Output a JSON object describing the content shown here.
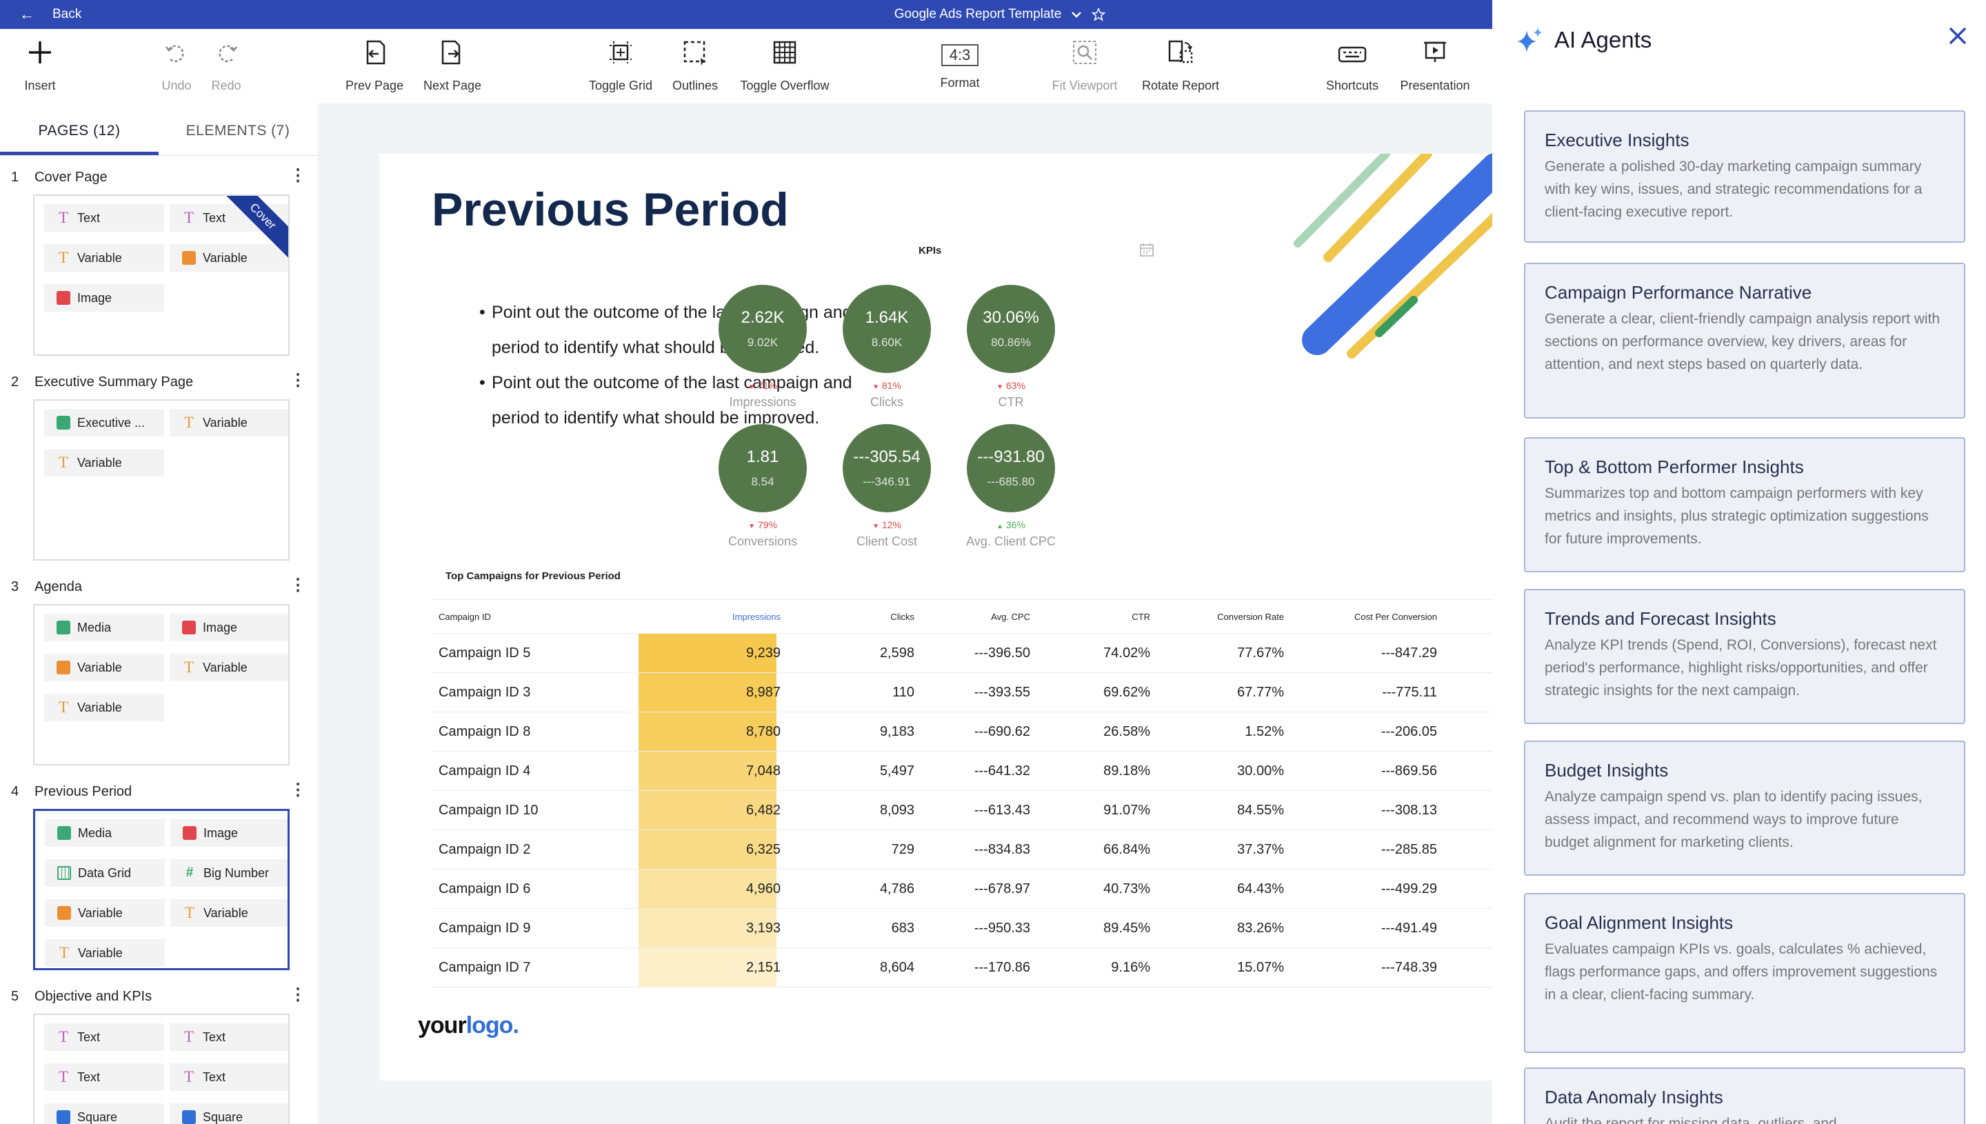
{
  "topbar": {
    "back_label": "Back",
    "doc_title": "Google Ads Report Template"
  },
  "toolbar": {
    "insert": "Insert",
    "undo": "Undo",
    "redo": "Redo",
    "prev_page": "Prev Page",
    "next_page": "Next Page",
    "toggle_grid": "Toggle Grid",
    "outlines": "Outlines",
    "toggle_overflow": "Toggle Overflow",
    "format_ratio": "4:3",
    "format": "Format",
    "fit_viewport": "Fit Viewport",
    "rotate_report": "Rotate Report",
    "shortcuts": "Shortcuts",
    "presentation": "Presentation"
  },
  "left_panel": {
    "tab_pages": "PAGES (12)",
    "tab_elements": "ELEMENTS (7)",
    "pages": [
      {
        "num": "1",
        "name": "Cover Page",
        "badge": "Cover",
        "chips": [
          {
            "icon": "text-icon",
            "label": "Text"
          },
          {
            "icon": "text-icon",
            "label": "Text"
          },
          {
            "icon": "variable-icon",
            "label": "Variable"
          },
          {
            "icon": "image-variable-icon",
            "label": "Variable"
          },
          {
            "icon": "image-icon",
            "label": "Image"
          }
        ]
      },
      {
        "num": "2",
        "name": "Executive Summary Page",
        "chips": [
          {
            "icon": "executive-icon",
            "label": "Executive ..."
          },
          {
            "icon": "variable-icon",
            "label": "Variable"
          },
          {
            "icon": "variable-icon",
            "label": "Variable"
          }
        ]
      },
      {
        "num": "3",
        "name": "Agenda",
        "chips": [
          {
            "icon": "media-icon",
            "label": "Media"
          },
          {
            "icon": "image-icon",
            "label": "Image"
          },
          {
            "icon": "image-variable-icon",
            "label": "Variable"
          },
          {
            "icon": "variable-icon",
            "label": "Variable"
          },
          {
            "icon": "variable-icon",
            "label": "Variable"
          }
        ]
      },
      {
        "num": "4",
        "name": "Previous Period",
        "chips": [
          {
            "icon": "media-icon",
            "label": "Media"
          },
          {
            "icon": "image-icon",
            "label": "Image"
          },
          {
            "icon": "data-grid-icon",
            "label": "Data Grid"
          },
          {
            "icon": "hash-icon",
            "label": "Big Number"
          },
          {
            "icon": "image-variable-icon",
            "label": "Variable"
          },
          {
            "icon": "variable-icon",
            "label": "Variable"
          },
          {
            "icon": "variable-icon",
            "label": "Variable"
          }
        ]
      },
      {
        "num": "5",
        "name": "Objective and KPIs",
        "chips": [
          {
            "icon": "text-icon",
            "label": "Text"
          },
          {
            "icon": "text-icon",
            "label": "Text"
          },
          {
            "icon": "text-icon",
            "label": "Text"
          },
          {
            "icon": "text-icon",
            "label": "Text"
          },
          {
            "icon": "square-icon",
            "label": "Square"
          },
          {
            "icon": "square-icon",
            "label": "Square"
          }
        ]
      }
    ]
  },
  "slide": {
    "title": "Previous Period",
    "bullets": [
      "Point out the outcome of the last campaign and period to identify what should be improved.",
      "Point out the outcome of the last campaign and period to identify what should be improved."
    ],
    "kpi_label": "KPIs",
    "kpis": [
      {
        "value": "2.62K",
        "prev": "9.02K",
        "change": "71%",
        "dir": "down",
        "name": "Impressions"
      },
      {
        "value": "1.64K",
        "prev": "8.60K",
        "change": "81%",
        "dir": "down",
        "name": "Clicks"
      },
      {
        "value": "30.06%",
        "prev": "80.86%",
        "change": "63%",
        "dir": "down",
        "name": "CTR"
      },
      {
        "value": "1.81",
        "prev": "8.54",
        "change": "79%",
        "dir": "down",
        "name": "Conversions"
      },
      {
        "value": "---305.54",
        "prev": "---346.91",
        "change": "12%",
        "dir": "down",
        "name": "Client Cost"
      },
      {
        "value": "---931.80",
        "prev": "---685.80",
        "change": "36%",
        "dir": "up",
        "name": "Avg. Client CPC"
      }
    ],
    "table_title": "Top Campaigns for Previous Period",
    "table": {
      "headers": [
        "Campaign ID",
        "Impressions",
        "Clicks",
        "Avg. CPC",
        "CTR",
        "Conversion Rate",
        "Cost Per Conversion"
      ],
      "rows": [
        {
          "id": "Campaign ID 5",
          "impressions": "9,239",
          "clicks": "2,598",
          "cpc": "---396.50",
          "ctr": "74.02%",
          "conv": "77.67%",
          "cpconv": "---847.29",
          "heat": 1.0
        },
        {
          "id": "Campaign ID 3",
          "impressions": "8,987",
          "clicks": "110",
          "cpc": "---393.55",
          "ctr": "69.62%",
          "conv": "67.77%",
          "cpconv": "---775.11",
          "heat": 0.94
        },
        {
          "id": "Campaign ID 8",
          "impressions": "8,780",
          "clicks": "9,183",
          "cpc": "---690.62",
          "ctr": "26.58%",
          "conv": "1.52%",
          "cpconv": "---206.05",
          "heat": 0.89
        },
        {
          "id": "Campaign ID 4",
          "impressions": "7,048",
          "clicks": "5,497",
          "cpc": "---641.32",
          "ctr": "89.18%",
          "conv": "30.00%",
          "cpconv": "---869.56",
          "heat": 0.74
        },
        {
          "id": "Campaign ID 10",
          "impressions": "6,482",
          "clicks": "8,093",
          "cpc": "---613.43",
          "ctr": "91.07%",
          "conv": "84.55%",
          "cpconv": "---308.13",
          "heat": 0.66
        },
        {
          "id": "Campaign ID 2",
          "impressions": "6,325",
          "clicks": "729",
          "cpc": "---834.83",
          "ctr": "66.84%",
          "conv": "37.37%",
          "cpconv": "---285.85",
          "heat": 0.62
        },
        {
          "id": "Campaign ID 6",
          "impressions": "4,960",
          "clicks": "4,786",
          "cpc": "---678.97",
          "ctr": "40.73%",
          "conv": "64.43%",
          "cpconv": "---499.29",
          "heat": 0.46
        },
        {
          "id": "Campaign ID 9",
          "impressions": "3,193",
          "clicks": "683",
          "cpc": "---950.33",
          "ctr": "89.45%",
          "conv": "83.26%",
          "cpconv": "---491.49",
          "heat": 0.3
        },
        {
          "id": "Campaign ID 7",
          "impressions": "2,151",
          "clicks": "8,604",
          "cpc": "---170.86",
          "ctr": "9.16%",
          "conv": "15.07%",
          "cpconv": "---748.39",
          "heat": 0.18
        }
      ]
    },
    "logo_a": "your",
    "logo_b": "logo."
  },
  "right_panel": {
    "title": "AI Agents",
    "cards": [
      {
        "title": "Executive Insights",
        "desc": "Generate a polished 30-day marketing campaign summary with key wins, issues, and strategic recommendations for a client-facing executive report."
      },
      {
        "title": "Campaign Performance Narrative",
        "desc": "Generate a clear, client-friendly campaign analysis report with sections on performance overview, key drivers, areas for attention, and next steps based on quarterly data."
      },
      {
        "title": "Top & Bottom Performer Insights",
        "desc": "Summarizes top and bottom campaign performers with key metrics and insights, plus strategic optimization suggestions for future improvements."
      },
      {
        "title": "Trends and Forecast Insights",
        "desc": "Analyze KPI trends (Spend, ROI, Conversions), forecast next period's performance, highlight risks/opportunities, and offer strategic insights for the next campaign."
      },
      {
        "title": "Budget Insights",
        "desc": "Analyze campaign spend vs. plan to identify pacing issues, assess impact, and recommend ways to improve future budget alignment for marketing clients."
      },
      {
        "title": "Goal Alignment Insights",
        "desc": "Evaluates campaign KPIs vs. goals, calculates % achieved, flags performance gaps, and offers improvement suggestions in a clear, client-facing summary."
      },
      {
        "title": "Data Anomaly Insights",
        "desc": "Audit the report for missing data, outliers, and"
      }
    ]
  },
  "colors": {
    "brand_blue": "#2f49b3",
    "kpi_green": "#55784a",
    "heat_max": "#f6c94e",
    "card_bg": "#eef0f8"
  }
}
